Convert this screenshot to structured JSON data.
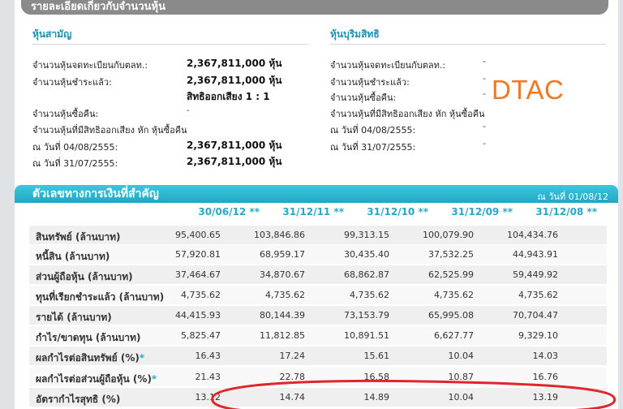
{
  "header": {
    "title": "รายละเอียดเกี่ยวกับจำนวนหุ้น"
  },
  "common": {
    "title": "หุ้นสามัญ",
    "rows": [
      {
        "label": "จำนวนหุ้นจดทะเบียนกับตลท.:",
        "value": "2,367,811,000 หุ้น"
      },
      {
        "label": "จำนวนหุ้นชำระแล้ว:",
        "value": "2,367,811,000 หุ้น"
      },
      {
        "label": "",
        "value": "สิทธิออกเสียง 1 : 1"
      },
      {
        "label": "จำนวนหุ้นซื้อคืน:",
        "value": "-"
      },
      {
        "label": "จำนวนหุ้นที่มีสิทธิออกเสียง หัก หุ้นซื้อคืน",
        "value": ""
      },
      {
        "label": "ณ วันที่ 04/08/2555:",
        "value": "2,367,811,000 หุ้น"
      },
      {
        "label": "ณ วันที่ 31/07/2555:",
        "value": "2,367,811,000 หุ้น"
      }
    ]
  },
  "preferred": {
    "title": "หุ้นบุริมสิทธิ",
    "rows": [
      {
        "label": "จำนวนหุ้นจดทะเบียนกับตลท.:",
        "value": "-"
      },
      {
        "label": "จำนวนหุ้นชำระแล้ว:",
        "value": "-"
      },
      {
        "label": "จำนวนหุ้นซื้อคืน:",
        "value": "-"
      },
      {
        "label": "จำนวนหุ้นที่มีสิทธิออกเสียง หัก หุ้นซื้อคืน",
        "value": ""
      },
      {
        "label": "ณ วันที่ 04/08/2555:",
        "value": "-"
      },
      {
        "label": "ณ วันที่ 31/07/2555:",
        "value": "-"
      }
    ]
  },
  "watermark": "DTAC",
  "financial": {
    "title": "ตัวเลขทางการเงินที่สำคัญ",
    "as_of": "ณ วันที่ 01/08/12",
    "columns": [
      "30/06/12 **",
      "31/12/11 **",
      "31/12/10 **",
      "31/12/09 **",
      "31/12/08 **"
    ],
    "rows": [
      {
        "label": "สินทรัพย์ (ล้านบาท)",
        "star": "",
        "values": [
          "95,400.65",
          "103,846.86",
          "99,313.15",
          "100,079.90",
          "104,434.76"
        ]
      },
      {
        "label": "หนี้สิน (ล้านบาท)",
        "star": "",
        "values": [
          "57,920.81",
          "68,959.17",
          "30,435.40",
          "37,532.25",
          "44,943.91"
        ]
      },
      {
        "label": "ส่วนผู้ถือหุ้น (ล้านบาท)",
        "star": "",
        "values": [
          "37,464.67",
          "34,870.67",
          "68,862.87",
          "62,525.99",
          "59,449.92"
        ]
      },
      {
        "label": "ทุนที่เรียกชำระแล้ว (ล้านบาท)",
        "star": "",
        "values": [
          "4,735.62",
          "4,735.62",
          "4,735.62",
          "4,735.62",
          "4,735.62"
        ]
      },
      {
        "label": "รายได้ (ล้านบาท)",
        "star": "",
        "values": [
          "44,415.93",
          "80,144.39",
          "73,153.79",
          "65,995.08",
          "70,704.47"
        ]
      },
      {
        "label": "กำไร/ขาดทุน (ล้านบาท)",
        "star": "",
        "values": [
          "5,825.47",
          "11,812.85",
          "10,891.51",
          "6,627.77",
          "9,329.10"
        ]
      },
      {
        "label": "ผลกำไรต่อสินทรัพย์ (%)",
        "star": "*",
        "values": [
          "16.43",
          "17.24",
          "15.61",
          "10.04",
          "14.03"
        ]
      },
      {
        "label": "ผลกำไรต่อส่วนผู้ถือหุ้น (%)",
        "star": "*",
        "values": [
          "21.43",
          "22.78",
          "16.58",
          "10.87",
          "16.76"
        ]
      },
      {
        "label": "อัตรากำไรสุทธิ (%)",
        "star": "",
        "values": [
          "13.12",
          "14.74",
          "14.89",
          "10.04",
          "13.19"
        ]
      }
    ]
  },
  "colors": {
    "accent": "#2aa7c8",
    "annotation": "#e0262b",
    "watermark": "#f07820"
  }
}
